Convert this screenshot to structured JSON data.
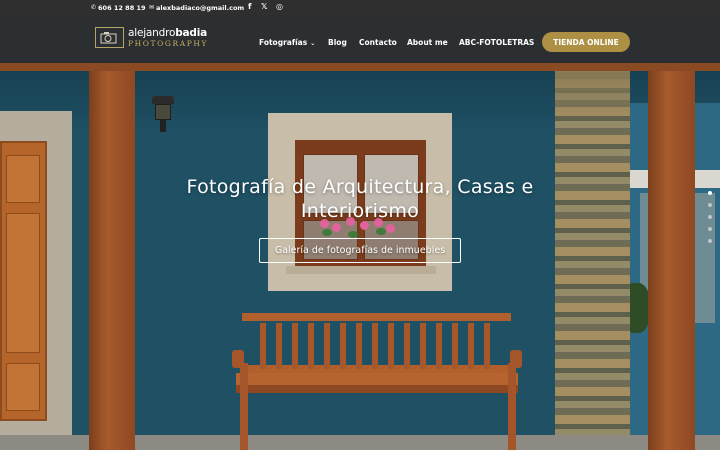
{
  "topbar": {
    "phone": "606 12 88 19",
    "email": "alexbadiaco@gmail.com",
    "social": [
      {
        "icon": "facebook-icon",
        "glyph": "f"
      },
      {
        "icon": "x-icon",
        "glyph": "𝕏"
      },
      {
        "icon": "instagram-icon",
        "glyph": "◎"
      }
    ]
  },
  "header": {
    "logo_name_regular": "alejandro",
    "logo_name_bold": "badia",
    "logo_sub": "PHOTOGRAPHY",
    "nav": [
      {
        "label": "Fotografías",
        "has_dropdown": true
      },
      {
        "label": "Blog"
      },
      {
        "label": "Contacto"
      },
      {
        "label": "About me"
      },
      {
        "label": "ABC-FOTOLETRAS"
      }
    ],
    "shop_button": "TIENDA ONLINE"
  },
  "hero": {
    "title": "Fotografía de Arquitectura, Casas e Interiorismo",
    "button": "Galería de fotografías de inmuebles"
  },
  "slider": {
    "count": 5,
    "active": 1
  },
  "colors": {
    "accent": "#ad9043",
    "topbar": "#2f2f2f",
    "header": "#2d2d2d"
  }
}
